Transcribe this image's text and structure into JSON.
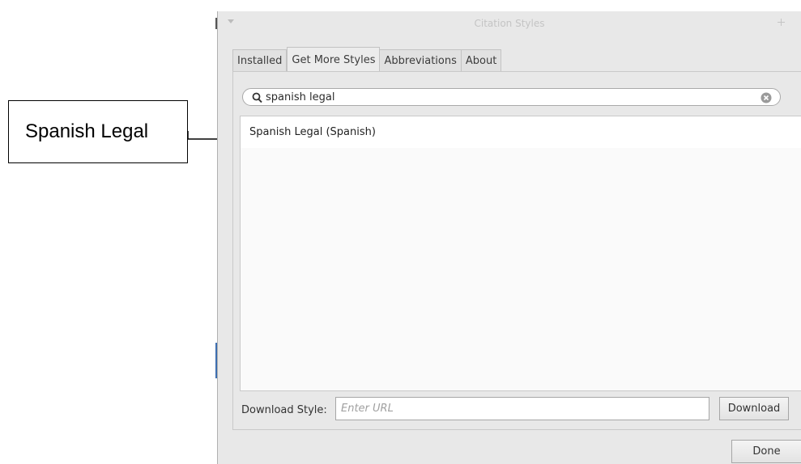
{
  "annotation": {
    "callout_text": "Spanish Legal"
  },
  "window": {
    "title": "Citation Styles",
    "menu_icon": "chevron-down-icon",
    "maximize_icon": "plus-icon"
  },
  "tabs": [
    {
      "label": "Installed",
      "active": false
    },
    {
      "label": "Get More Styles",
      "active": true
    },
    {
      "label": "Abbreviations",
      "active": false
    },
    {
      "label": "About",
      "active": false
    }
  ],
  "search": {
    "value": "spanish legal",
    "icon": "search-icon",
    "clear_icon": "clear-icon"
  },
  "results": [
    {
      "label": "Spanish Legal (Spanish)"
    }
  ],
  "download": {
    "label": "Download Style:",
    "placeholder": "Enter URL",
    "button_label": "Download"
  },
  "footer": {
    "done_label": "Done"
  },
  "colors": {
    "window_bg": "#e8e8e8",
    "list_bg": "#fafafa",
    "accent_edge": "#3d6fb0"
  }
}
